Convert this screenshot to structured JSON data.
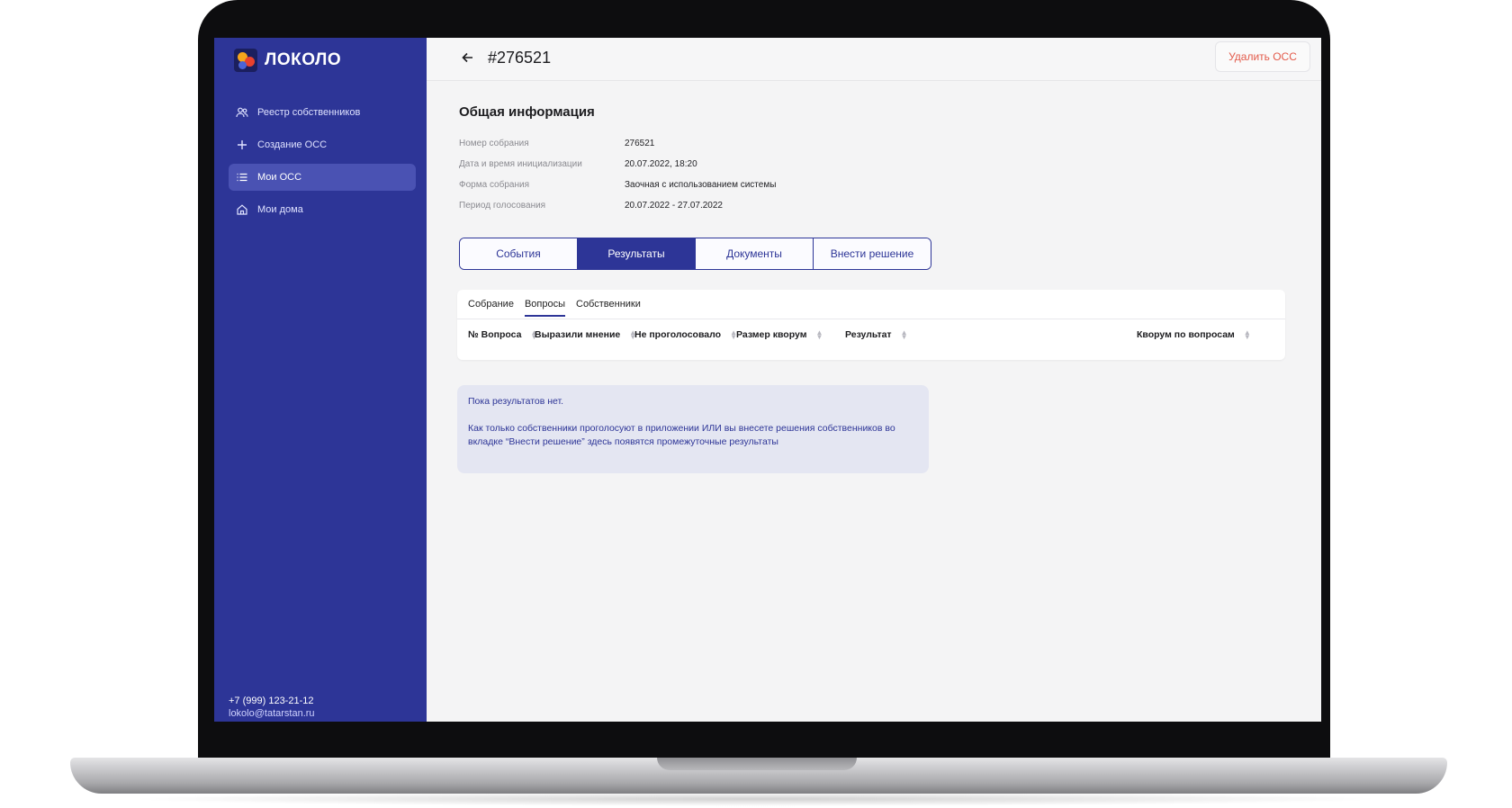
{
  "app": {
    "logo_text": "ЛОКОЛО"
  },
  "sidebar": {
    "items": [
      {
        "label": "Реестр собственников",
        "icon": "users-icon"
      },
      {
        "label": "Создание ОСС",
        "icon": "plus-icon"
      },
      {
        "label": "Мои ОСС",
        "icon": "list-icon",
        "active": true
      },
      {
        "label": "Мои дома",
        "icon": "home-icon"
      }
    ],
    "footer": {
      "phone": "+7 (999) 123-21-12",
      "email": "lokolo@tatarstan.ru"
    }
  },
  "header": {
    "title": "#276521",
    "delete_label": "Удалить ОСС"
  },
  "info": {
    "section_title": "Общая информация",
    "rows": [
      {
        "label": "Номер собрания",
        "value": "276521"
      },
      {
        "label": "Дата и время инициализации",
        "value": "20.07.2022, 18:20"
      },
      {
        "label": "Форма собрания",
        "value": "Заочная с использованием системы"
      },
      {
        "label": "Период голосования",
        "value": "20.07.2022 - 27.07.2022"
      }
    ]
  },
  "tabs": [
    {
      "label": "События"
    },
    {
      "label": "Результаты",
      "active": true
    },
    {
      "label": "Документы"
    },
    {
      "label": "Внести решение"
    }
  ],
  "subtabs": [
    {
      "label": "Собрание"
    },
    {
      "label": "Вопросы",
      "active": true
    },
    {
      "label": "Собственники"
    }
  ],
  "table": {
    "columns": [
      "№ Вопроса",
      "Выразили мнение",
      "Не проголосовало",
      "Размер кворум",
      "Результат",
      "Кворум по вопросам"
    ]
  },
  "notice": {
    "title": "Пока результатов нет.",
    "text": "Как только собственники проголосуют в приложении ИЛИ вы внесете решения собственников во вкладке  “Внести решение”  здесь появятся промежуточные результаты"
  },
  "colors": {
    "sidebar_bg": "#2d3597",
    "accent": "#2d3597",
    "danger": "#e35a4a",
    "notice_bg": "#e4e6f2"
  }
}
